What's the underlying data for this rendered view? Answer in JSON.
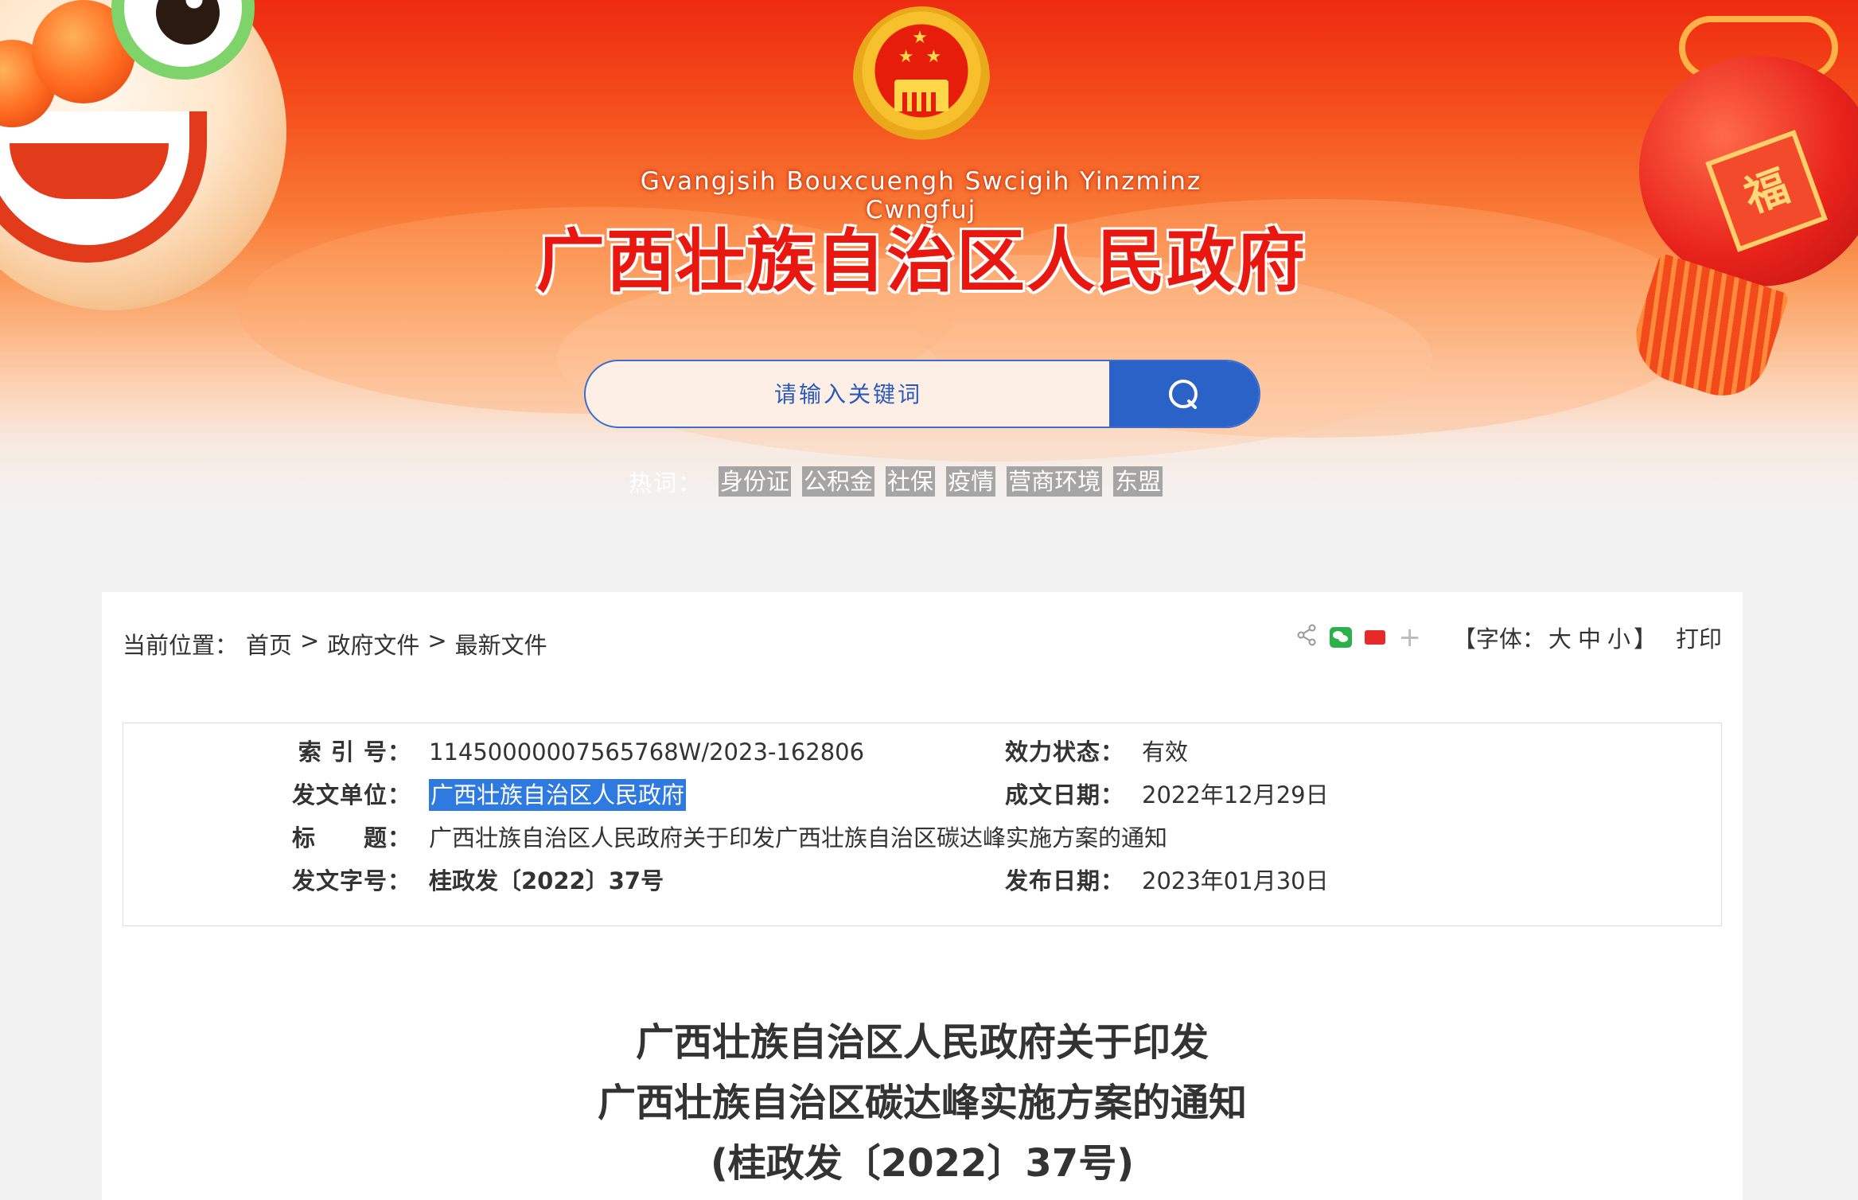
{
  "header": {
    "site_pinyin": "Gvangjsih Bouxcuengh Swcigih Yinzminz Cwngfuj",
    "site_title": "广西壮族自治区人民政府",
    "search": {
      "placeholder": "请输入关键词",
      "button_icon": "search-icon"
    },
    "hotwords": {
      "label": "热词：",
      "items": [
        "身份证",
        "公积金",
        "社保",
        "疫情",
        "营商环境",
        "东盟"
      ]
    },
    "decorations": [
      "national-emblem",
      "lion-dance-head",
      "red-lantern"
    ]
  },
  "breadcrumb": {
    "label": "当前位置：",
    "items": [
      "首页",
      "政府文件",
      "最新文件"
    ],
    "separator": ">"
  },
  "tools": {
    "share_icons": [
      "share-icon",
      "wechat-icon",
      "toutiao-icon",
      "plus-icon"
    ],
    "font_label": "【字体：",
    "font_options": [
      "大",
      "中",
      "小"
    ],
    "font_close": "】",
    "print": "打印"
  },
  "meta": {
    "index_no_label": "索 引 号：",
    "index_no": "11450000007565768W/2023-162806",
    "status_label": "效力状态：",
    "status": "有效",
    "issuer_label": "发文单位：",
    "issuer": "广西壮族自治区人民政府",
    "created_label": "成文日期：",
    "created": "2022年12月29日",
    "subject_label": "标　　题：",
    "subject": "广西壮族自治区人民政府关于印发广西壮族自治区碳达峰实施方案的通知",
    "doc_no_label": "发文字号：",
    "doc_no": "桂政发〔2022〕37号",
    "published_label": "发布日期：",
    "published": "2023年01月30日"
  },
  "document": {
    "title_lines": [
      "广西壮族自治区人民政府关于印发",
      "广西壮族自治区碳达峰实施方案的通知",
      "(桂政发〔2022〕37号)"
    ]
  },
  "colors": {
    "banner_red": "#ee2a10",
    "title_red": "#e8170f",
    "search_blue": "#2b62c8",
    "selection_blue": "#2f7ae0",
    "page_bg": "#f2f2f2"
  }
}
